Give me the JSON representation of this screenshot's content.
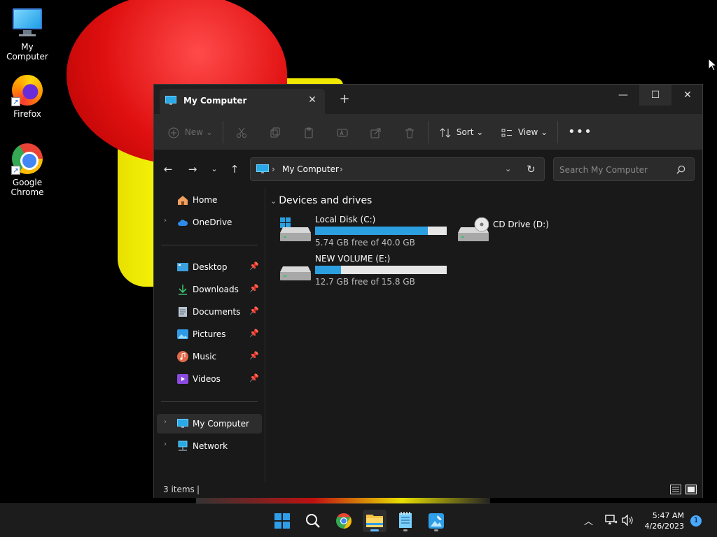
{
  "desktop": {
    "icons": [
      {
        "label": "My Computer",
        "icon": "monitor-icon"
      },
      {
        "label": "Firefox",
        "icon": "firefox-icon"
      },
      {
        "label": "Google Chrome",
        "icon": "chrome-icon"
      }
    ]
  },
  "window": {
    "tab_title": "My Computer",
    "toolbar": {
      "new_label": "New",
      "sort_label": "Sort",
      "view_label": "View"
    },
    "address": {
      "crumb": "My Computer"
    },
    "search": {
      "placeholder": "Search My Computer"
    },
    "sidebar": {
      "items": [
        {
          "label": "Home",
          "icon": "home-icon"
        },
        {
          "label": "OneDrive",
          "icon": "cloud-icon"
        },
        {
          "label": "Desktop",
          "icon": "desktop-icon"
        },
        {
          "label": "Downloads",
          "icon": "download-icon"
        },
        {
          "label": "Documents",
          "icon": "document-icon"
        },
        {
          "label": "Pictures",
          "icon": "picture-icon"
        },
        {
          "label": "Music",
          "icon": "music-icon"
        },
        {
          "label": "Videos",
          "icon": "video-icon"
        },
        {
          "label": "My Computer",
          "icon": "monitor-icon"
        },
        {
          "label": "Network",
          "icon": "network-icon"
        }
      ]
    },
    "content": {
      "group_header": "Devices and drives",
      "drives": [
        {
          "name": "Local Disk (C:)",
          "free": "5.74 GB free of 40.0 GB",
          "used_fraction": 0.857
        },
        {
          "name": "CD Drive (D:)"
        },
        {
          "name": "NEW VOLUME (E:)",
          "free": "12.7 GB free of 15.8 GB",
          "used_fraction": 0.196
        }
      ]
    },
    "status": {
      "count": "3 items"
    }
  },
  "taskbar": {
    "time": "5:47 AM",
    "date": "4/26/2023",
    "notifications": "1"
  },
  "colors": {
    "accent": "#2b9fe0",
    "window_bg": "#191919",
    "toolbar_bg": "#2c2c2c"
  }
}
